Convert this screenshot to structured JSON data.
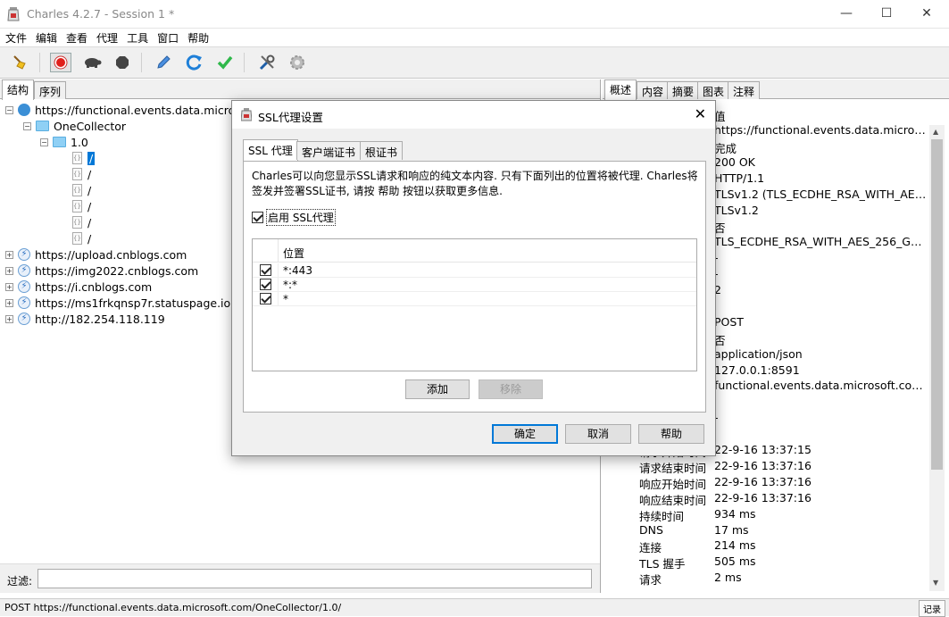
{
  "window": {
    "title": "Charles 4.2.7 - Session 1 *",
    "minimize": "—",
    "maximize": "☐",
    "close": "✕"
  },
  "menu": [
    "文件",
    "编辑",
    "查看",
    "代理",
    "工具",
    "窗口",
    "帮助"
  ],
  "toolbar": {
    "icons": [
      "broom-icon",
      "record-icon",
      "throttle-turtle-icon",
      "breakpoint-hexagon-icon",
      "compose-pen-icon",
      "repeat-refresh-icon",
      "validate-check-icon",
      "tools-icon",
      "settings-gear-icon"
    ],
    "colors": {
      "record": "#e0201b",
      "refresh": "#1e7fd8",
      "check": "#2fb84a"
    }
  },
  "left": {
    "tabs": [
      "结构",
      "序列"
    ],
    "tree": [
      {
        "label": "https://functional.events.data.microso",
        "expanded": true
      },
      {
        "label": "OneCollector",
        "expanded": true
      },
      {
        "label": "1.0",
        "expanded": true
      },
      {
        "label": "/"
      },
      {
        "label": "/"
      },
      {
        "label": "/"
      },
      {
        "label": "/"
      },
      {
        "label": "/"
      },
      {
        "label": "/"
      },
      {
        "label": "https://upload.cnblogs.com"
      },
      {
        "label": "https://img2022.cnblogs.com"
      },
      {
        "label": "https://i.cnblogs.com"
      },
      {
        "label": "https://ms1frkqnsp7r.statuspage.io"
      },
      {
        "label": "http://182.254.118.119"
      }
    ],
    "filter_label": "过滤:",
    "filter_value": ""
  },
  "right": {
    "tabs": [
      "概述",
      "内容",
      "摘要",
      "图表",
      "注释"
    ],
    "header_value": "值",
    "rows": [
      {
        "k": "",
        "v": "https://functional.events.data.microsoft...."
      },
      {
        "k": "",
        "v": "完成"
      },
      {
        "k": "",
        "v": "200 OK"
      },
      {
        "k": "",
        "v": "HTTP/1.1"
      },
      {
        "k": "",
        "v": "TLSv1.2 (TLS_ECDHE_RSA_WITH_AES_25..."
      },
      {
        "k": "",
        "v": "TLSv1.2"
      },
      {
        "k": "",
        "v": "否"
      },
      {
        "k": "",
        "v": "TLS_ECDHE_RSA_WITH_AES_256_GCM_..."
      },
      {
        "k": "",
        "v": "-"
      },
      {
        "k": "",
        "v": "-"
      },
      {
        "k": "",
        "v": "2"
      },
      {
        "k": "",
        "v": ""
      },
      {
        "k": "",
        "v": "POST"
      },
      {
        "k": "",
        "v": "否"
      },
      {
        "k": "",
        "v": "application/json"
      },
      {
        "k": "",
        "v": "127.0.0.1:8591"
      },
      {
        "k": "",
        "v": "functional.events.data.microsoft.com/2..."
      },
      {
        "k": "",
        "v": ""
      },
      {
        "k": "",
        "v": "-"
      },
      {
        "k": "",
        "v": ""
      },
      {
        "k": "请求开始时间",
        "v": "22-9-16 13:37:15"
      },
      {
        "k": "请求结束时间",
        "v": "22-9-16 13:37:16"
      },
      {
        "k": "响应开始时间",
        "v": "22-9-16 13:37:16"
      },
      {
        "k": "响应结束时间",
        "v": "22-9-16 13:37:16"
      },
      {
        "k": "持续时间",
        "v": "934 ms"
      },
      {
        "k": "DNS",
        "v": "17 ms"
      },
      {
        "k": "连接",
        "v": "214 ms"
      },
      {
        "k": "TLS 握手",
        "v": "505 ms"
      },
      {
        "k": "请求",
        "v": "2 ms"
      }
    ]
  },
  "status": {
    "text": "POST https://functional.events.data.microsoft.com/OneCollector/1.0/",
    "record_label": "记录"
  },
  "dialog": {
    "title": "SSL代理设置",
    "tabs": [
      "SSL 代理",
      "客户端证书",
      "根证书"
    ],
    "description": "Charles可以向您显示SSL请求和响应的纯文本内容. 只有下面列出的位置将被代理. Charles将签发并签署SSL证书, 请按 帮助 按钮以获取更多信息.",
    "enable_label": "启用 SSL代理",
    "enable_checked": true,
    "table_header": "位置",
    "locations": [
      {
        "value": "*:443",
        "checked": true
      },
      {
        "value": "*:*",
        "checked": true
      },
      {
        "value": "*",
        "checked": true
      }
    ],
    "add_label": "添加",
    "remove_label": "移除",
    "ok_label": "确定",
    "cancel_label": "取消",
    "help_label": "帮助"
  }
}
